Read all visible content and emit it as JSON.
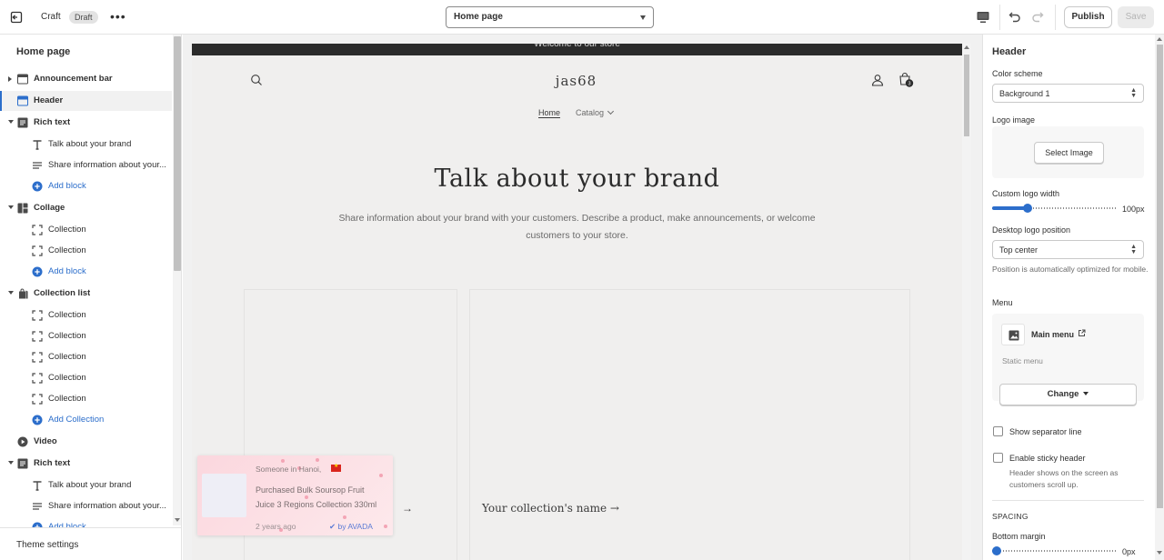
{
  "topbar": {
    "theme_name": "Craft",
    "status_badge": "Draft",
    "more": "•••",
    "page_select": "Home page",
    "publish_label": "Publish",
    "save_label": "Save"
  },
  "sidebar": {
    "title": "Home page",
    "items": [
      {
        "kind": "sec",
        "label": "Announcement bar",
        "icon": "announcement-bar-icon",
        "arrow": "right"
      },
      {
        "kind": "sec",
        "label": "Header",
        "icon": "header-layout-icon",
        "selected": true
      },
      {
        "kind": "sec",
        "label": "Rich text",
        "icon": "rich-text-icon",
        "arrow": "down"
      },
      {
        "kind": "child",
        "label": "Talk about your brand",
        "icon": "text-heading-icon"
      },
      {
        "kind": "child",
        "label": "Share information about your...",
        "icon": "paragraph-icon"
      },
      {
        "kind": "add",
        "label": "Add block",
        "icon": "add-circle-icon"
      },
      {
        "kind": "sec",
        "label": "Collage",
        "icon": "collage-icon",
        "arrow": "down"
      },
      {
        "kind": "child",
        "label": "Collection",
        "icon": "collection-frame-icon"
      },
      {
        "kind": "child",
        "label": "Collection",
        "icon": "collection-frame-icon"
      },
      {
        "kind": "add",
        "label": "Add block",
        "icon": "add-circle-icon"
      },
      {
        "kind": "sec",
        "label": "Collection list",
        "icon": "collection-list-icon",
        "arrow": "down"
      },
      {
        "kind": "child",
        "label": "Collection",
        "icon": "collection-frame-icon"
      },
      {
        "kind": "child",
        "label": "Collection",
        "icon": "collection-frame-icon"
      },
      {
        "kind": "child",
        "label": "Collection",
        "icon": "collection-frame-icon"
      },
      {
        "kind": "child",
        "label": "Collection",
        "icon": "collection-frame-icon"
      },
      {
        "kind": "child",
        "label": "Collection",
        "icon": "collection-frame-icon"
      },
      {
        "kind": "add",
        "label": "Add Collection",
        "icon": "add-circle-icon"
      },
      {
        "kind": "sec",
        "label": "Video",
        "icon": "video-play-icon"
      },
      {
        "kind": "sec",
        "label": "Rich text",
        "icon": "rich-text-icon",
        "arrow": "down"
      },
      {
        "kind": "child",
        "label": "Talk about your brand",
        "icon": "text-heading-icon"
      },
      {
        "kind": "child",
        "label": "Share information about your...",
        "icon": "paragraph-icon"
      },
      {
        "kind": "add",
        "label": "Add block",
        "icon": "add-circle-icon"
      }
    ],
    "footer": "Theme settings"
  },
  "preview": {
    "announcement": "Welcome to our store",
    "logo_text": "jas68",
    "cart_count": "3",
    "nav": {
      "home": "Home",
      "catalog": "Catalog"
    },
    "hero": {
      "title": "Talk about your brand",
      "text": "Share information about your brand with your customers. Describe a product, make announcements, or welcome customers to your store."
    },
    "collection_label": "Your collection's name →",
    "card_arrow": "→",
    "popup": {
      "who": "Someone in Hanoi,",
      "product": "Purchased Bulk Soursop Fruit Juice 3 Regions Collection 330ml",
      "ago": "2 years ago",
      "by": "✔ by AVADA"
    }
  },
  "settings": {
    "title": "Header",
    "color_scheme": {
      "label": "Color scheme",
      "value": "Background 1"
    },
    "logo_image": {
      "label": "Logo image",
      "button": "Select Image"
    },
    "logo_width": {
      "label": "Custom logo width",
      "value_text": "100px",
      "fraction": 0.27
    },
    "logo_position": {
      "label": "Desktop logo position",
      "value": "Top center",
      "help": "Position is automatically optimized for mobile."
    },
    "menu": {
      "label": "Menu",
      "name": "Main menu",
      "type": "Static menu",
      "button": "Change"
    },
    "separator": {
      "label": "Show separator line",
      "checked": false
    },
    "sticky": {
      "label": "Enable sticky header",
      "help": "Header shows on the screen as customers scroll up.",
      "checked": false
    },
    "spacing_heading": "SPACING",
    "bottom_margin": {
      "label": "Bottom margin",
      "value_text": "0px",
      "fraction": 0
    }
  },
  "colors": {
    "accent": "#2c6ecb",
    "announcement_bg": "#2b2b2b",
    "preview_bg": "#f0efee"
  }
}
